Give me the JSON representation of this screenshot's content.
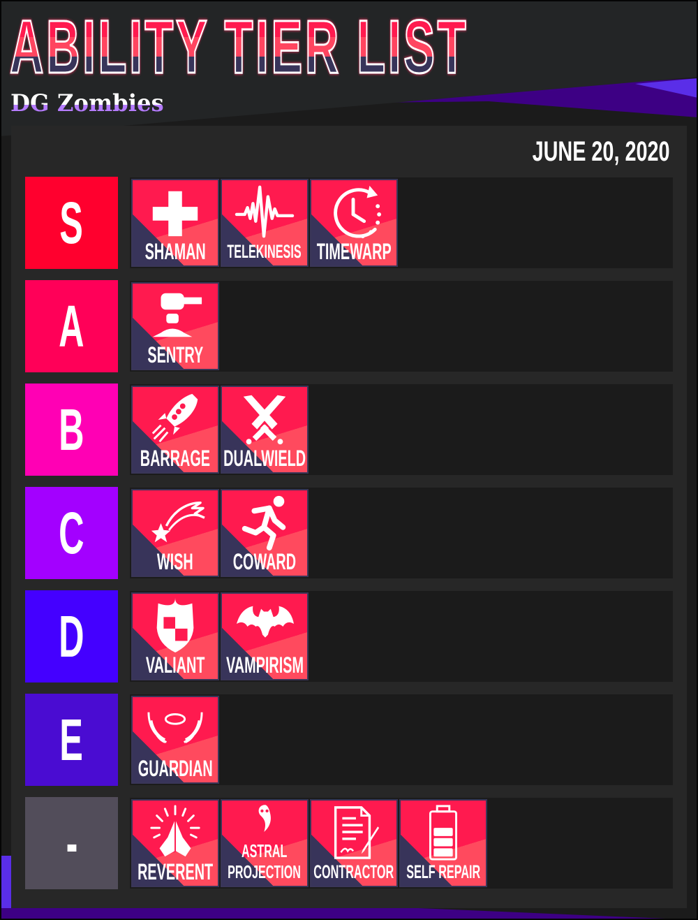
{
  "header": {
    "title": "ABILITY TIER LIST",
    "subtitle": "DG Zombies",
    "date": "JUNE 20, 2020"
  },
  "colors": {
    "card_top": "#ff1a4f",
    "card_mid": "#ff4a5e",
    "card_corner": "#38345a",
    "panel": "#272727",
    "track": "#1b1b1b",
    "accent_purple": "#3d0084",
    "accent_violet": "#5a2ee8"
  },
  "tiers": [
    {
      "label": "S",
      "color": "#ff002e",
      "abilities": [
        {
          "name": "SHAMAN",
          "icon": "medical-cross-icon"
        },
        {
          "name": "TELEKINESIS",
          "icon": "waveform-icon"
        },
        {
          "name": "TIMEWARP",
          "icon": "clock-rewind-icon"
        }
      ]
    },
    {
      "label": "A",
      "color": "#ff0058",
      "abilities": [
        {
          "name": "SENTRY",
          "icon": "turret-icon"
        }
      ]
    },
    {
      "label": "B",
      "color": "#ff00b4",
      "abilities": [
        {
          "name": "BARRAGE",
          "icon": "rocket-icon"
        },
        {
          "name": "DUALWIELD",
          "icon": "crossed-swords-icon"
        }
      ]
    },
    {
      "label": "C",
      "color": "#a300ff",
      "abilities": [
        {
          "name": "WISH",
          "icon": "shooting-star-icon"
        },
        {
          "name": "COWARD",
          "icon": "running-person-icon"
        }
      ]
    },
    {
      "label": "D",
      "color": "#4400ff",
      "abilities": [
        {
          "name": "VALIANT",
          "icon": "shield-icon"
        },
        {
          "name": "VAMPIRISM",
          "icon": "bat-icon"
        }
      ]
    },
    {
      "label": "E",
      "color": "#4a0cd2",
      "abilities": [
        {
          "name": "GUARDIAN",
          "icon": "angel-wings-halo-icon"
        }
      ]
    },
    {
      "label": "-",
      "color": "#524d5a",
      "abilities": [
        {
          "name": "REVERENT",
          "icon": "praying-hands-icon"
        },
        {
          "name": "ASTRAL PROJECTION",
          "name_line1": "ASTRAL",
          "name_line2": "PROJECTION",
          "icon": "ghost-icon"
        },
        {
          "name": "CONTRACTOR",
          "icon": "contract-pen-icon"
        },
        {
          "name": "SELF REPAIR",
          "icon": "battery-icon"
        }
      ]
    }
  ]
}
